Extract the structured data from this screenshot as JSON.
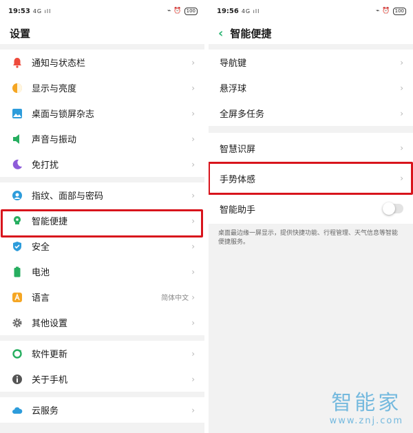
{
  "left": {
    "status": {
      "time": "19:53",
      "signal": "4G ıll",
      "battery": "100"
    },
    "title": "设置",
    "groups": [
      [
        {
          "label": "通知与状态栏",
          "icon": "bell-icon",
          "color": "#ee4b3c"
        },
        {
          "label": "显示与亮度",
          "icon": "brightness-icon",
          "color": "#f5a623"
        },
        {
          "label": "桌面与锁屏杂志",
          "icon": "wallpaper-icon",
          "color": "#2d9cdb"
        },
        {
          "label": "声音与振动",
          "icon": "speaker-icon",
          "color": "#27ae60"
        },
        {
          "label": "免打扰",
          "icon": "moon-icon",
          "color": "#8e5cd9"
        }
      ],
      [
        {
          "label": "指纹、面部与密码",
          "icon": "fingerprint-icon",
          "color": "#2d9cdb"
        },
        {
          "label": "智能便捷",
          "icon": "smart-bulb-icon",
          "color": "#27ae60"
        },
        {
          "label": "安全",
          "icon": "shield-icon",
          "color": "#2d9cdb"
        },
        {
          "label": "电池",
          "icon": "battery-icon",
          "color": "#27ae60"
        },
        {
          "label": "语言",
          "value": "简体中文",
          "icon": "language-icon",
          "color": "#f5a623"
        },
        {
          "label": "其他设置",
          "icon": "gear-icon",
          "color": "#666666"
        }
      ],
      [
        {
          "label": "软件更新",
          "icon": "update-icon",
          "color": "#27ae60"
        },
        {
          "label": "关于手机",
          "icon": "info-icon",
          "color": "#555555"
        }
      ],
      [
        {
          "label": "云服务",
          "icon": "cloud-icon",
          "color": "#2d9cdb"
        }
      ]
    ]
  },
  "right": {
    "status": {
      "time": "19:56",
      "signal": "4G ıll",
      "battery": "100"
    },
    "back_icon": "back-arrow-icon",
    "title": "智能便捷",
    "groups": [
      [
        {
          "label": "导航键"
        },
        {
          "label": "悬浮球"
        },
        {
          "label": "全屏多任务"
        }
      ],
      [
        {
          "label": "智慧识屏"
        },
        {
          "label": "手势体感"
        },
        {
          "label": "智能助手",
          "toggle": false
        }
      ]
    ],
    "description": "桌面最边缘一屏显示，提供快捷功能、行程管理、天气信息等智能便捷服务。"
  },
  "watermark": {
    "title": "智能家",
    "url": "www.znj.com"
  },
  "colors": {
    "highlight": "#d8141c",
    "accent": "#2bb673"
  }
}
